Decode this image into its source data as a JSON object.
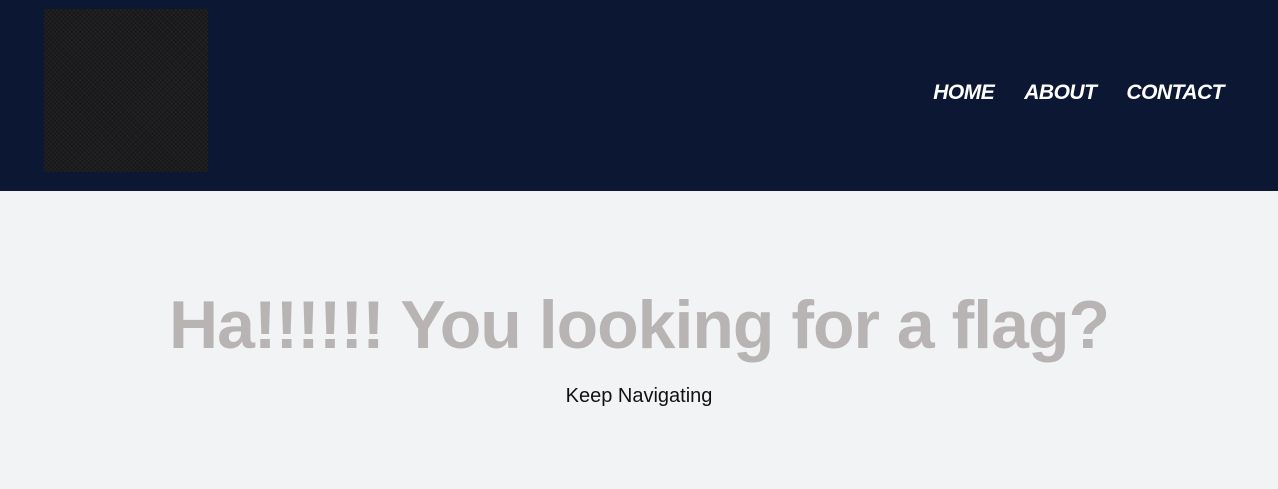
{
  "header": {
    "nav": [
      {
        "label": "HOME"
      },
      {
        "label": "ABOUT"
      },
      {
        "label": "CONTACT"
      }
    ]
  },
  "hero": {
    "title": "Ha!!!!!! You looking for a flag?",
    "subtitle": "Keep Navigating"
  },
  "colors": {
    "header_bg": "#0c1733",
    "page_bg": "#f2f3f5",
    "title_color": "#b8b4b4"
  }
}
